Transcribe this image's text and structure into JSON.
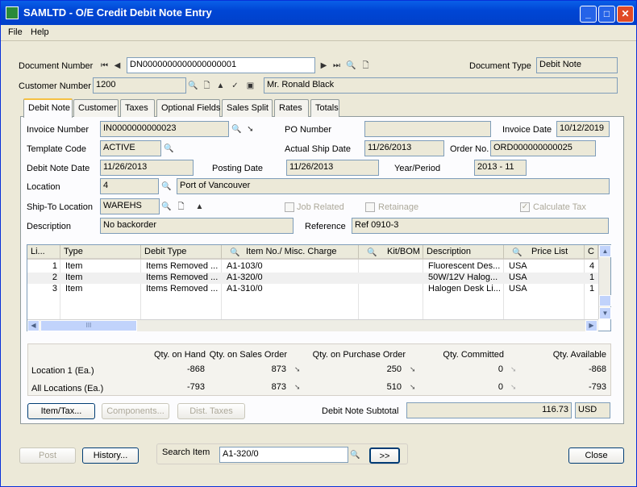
{
  "window": {
    "title": "SAMLTD - O/E Credit Debit Note Entry",
    "minimize": "_",
    "maximize": "□",
    "close": "✕"
  },
  "menu": {
    "file": "File",
    "help": "Help"
  },
  "header": {
    "doc_number_label": "Document Number",
    "doc_number": "DN0000000000000000001",
    "doc_type_label": "Document Type",
    "doc_type": "Debit Note",
    "customer_number_label": "Customer Number",
    "customer_number": "1200",
    "customer_name": "Mr. Ronald Black"
  },
  "tabs": [
    "Debit Note",
    "Customer",
    "Taxes",
    "Optional Fields",
    "Sales Split",
    "Rates",
    "Totals"
  ],
  "form": {
    "invoice_number_label": "Invoice Number",
    "invoice_number": "IN0000000000023",
    "po_number_label": "PO Number",
    "po_number": "",
    "invoice_date_label": "Invoice Date",
    "invoice_date": "10/12/2019",
    "template_code_label": "Template Code",
    "template_code": "ACTIVE",
    "actual_ship_date_label": "Actual Ship Date",
    "actual_ship_date": "11/26/2013",
    "order_no_label": "Order No.",
    "order_no": "ORD000000000025",
    "debit_note_date_label": "Debit Note Date",
    "debit_note_date": "11/26/2013",
    "posting_date_label": "Posting Date",
    "posting_date": "11/26/2013",
    "year_period_label": "Year/Period",
    "year_period": "2013 - 11",
    "location_label": "Location",
    "location": "4",
    "location_desc": "Port of Vancouver",
    "ship_to_label": "Ship-To Location",
    "ship_to": "WAREHS",
    "job_related": "Job Related",
    "retainage": "Retainage",
    "calculate_tax": "Calculate Tax",
    "description_label": "Description",
    "description": "No backorder",
    "reference_label": "Reference",
    "reference": "Ref 0910-3"
  },
  "grid": {
    "headers": [
      "Li...",
      "Type",
      "Debit Type",
      "Item No./ Misc. Charge",
      "Kit/BOM",
      "Description",
      "Price List",
      "C"
    ],
    "rows": [
      {
        "line": "1",
        "type": "Item",
        "debit_type": "Items Removed ...",
        "item": "A1-103/0",
        "kit": "",
        "desc": "Fluorescent Des...",
        "price_list": "USA",
        "c": "4"
      },
      {
        "line": "2",
        "type": "Item",
        "debit_type": "Items Removed ...",
        "item": "A1-320/0",
        "kit": "",
        "desc": "50W/12V Halog...",
        "price_list": "USA",
        "c": "1"
      },
      {
        "line": "3",
        "type": "Item",
        "debit_type": "Items Removed ...",
        "item": "A1-310/0",
        "kit": "",
        "desc": "Halogen Desk Li...",
        "price_list": "USA",
        "c": "1"
      }
    ],
    "hscroll": "III"
  },
  "summary": {
    "headers": [
      "Qty. on Hand",
      "Qty. on Sales Order",
      "Qty. on Purchase Order",
      "Qty. Committed",
      "Qty. Available"
    ],
    "rows": [
      {
        "label": "Location  1 (Ea.)",
        "on_hand": "-868",
        "sales": "873",
        "purchase": "250",
        "committed": "0",
        "available": "-868"
      },
      {
        "label": "All Locations (Ea.)",
        "on_hand": "-793",
        "sales": "873",
        "purchase": "510",
        "committed": "0",
        "available": "-793"
      }
    ]
  },
  "buttons": {
    "item_tax": "Item/Tax...",
    "components": "Components...",
    "dist_taxes": "Dist. Taxes",
    "subtotal_label": "Debit Note Subtotal",
    "subtotal": "116.73",
    "currency": "USD",
    "post": "Post",
    "history": "History...",
    "search_item_label": "Search Item",
    "search_item": "A1-320/0",
    "go": ">>",
    "close": "Close"
  },
  "colors": {
    "title_bar": "#0046d5",
    "dialog_bg": "#ece9d8",
    "accent_tab": "#f5c042"
  }
}
